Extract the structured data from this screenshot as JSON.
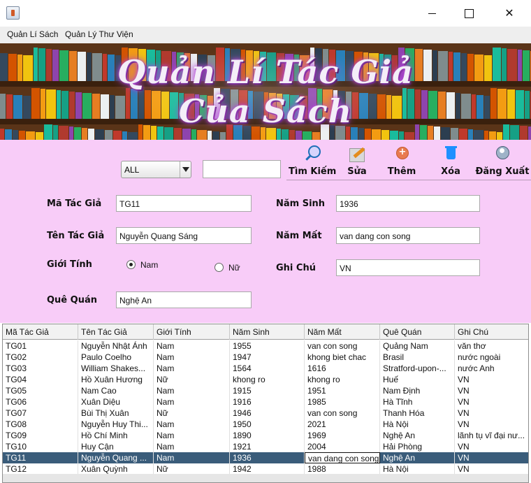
{
  "window": {
    "minimize": "",
    "maximize": "",
    "close": "✕"
  },
  "menu": [
    "Quản Lí Sách",
    "Quản Lý Thư Viện"
  ],
  "banner": {
    "line1": "Quản Lí Tác Giả",
    "line2": "Của Sách"
  },
  "filter": {
    "combo_value": "ALL",
    "search_value": ""
  },
  "toolbar": {
    "search": "Tìm Kiếm",
    "edit": "Sửa",
    "add": "Thêm",
    "delete": "Xóa",
    "logout": "Đăng Xuất"
  },
  "form": {
    "ma_label": "Mã Tác Giả",
    "ma_value": "TG11",
    "ten_label": "Tên Tác Giả",
    "ten_value": "Nguyễn Quang Sáng",
    "gioitinh_label": "Giới Tính",
    "nam_label": "Nam",
    "nu_label": "Nữ",
    "gender_selected": "Nam",
    "que_label": "Quê Quán",
    "que_value": "Nghệ An",
    "namsinh_label": "Năm Sinh",
    "namsinh_value": "1936",
    "nammat_label": "Năm Mất",
    "nammat_value": "van dang con song",
    "ghichu_label": "Ghi Chú",
    "ghichu_value": "VN"
  },
  "table": {
    "columns": [
      "Mã Tác Giả",
      "Tên Tác Giả",
      "Giới Tính",
      "Năm Sinh",
      "Năm Mất",
      "Quê Quán",
      "Ghi Chú"
    ],
    "selected_row": 10,
    "rows": [
      [
        "TG01",
        "Nguyễn Nhật Ánh",
        "Nam",
        "1955",
        "van con song",
        " Quảng Nam",
        "văn thơ"
      ],
      [
        "TG02",
        "Paulo Coelho",
        "Nam",
        "1947",
        "khong biet chac",
        "Brasil",
        "nước ngoài"
      ],
      [
        "TG03",
        "William Shakes...",
        "Nam",
        "1564",
        "1616",
        " Stratford-upon-...",
        "nước Anh"
      ],
      [
        "TG04",
        "Hồ Xuân Hương",
        "Nữ",
        "khong ro",
        "khong ro",
        "Huế",
        "VN"
      ],
      [
        "TG05",
        "Nam Cao",
        "Nam",
        "1915",
        "1951",
        "Nam Định",
        "VN"
      ],
      [
        "TG06",
        "Xuân Diệu",
        "Nam",
        "1916",
        "1985",
        "Hà Tĩnh",
        "VN"
      ],
      [
        "TG07",
        "Bùi Thị Xuân",
        "Nữ",
        "1946",
        "van con song",
        "Thanh Hóa",
        "VN"
      ],
      [
        "TG08",
        "Nguyễn Huy Thi...",
        "Nam",
        "1950",
        "2021",
        "Hà Nội",
        "VN"
      ],
      [
        "TG09",
        "Hồ Chí Minh",
        "Nam",
        "1890",
        "1969",
        "Nghệ An",
        "lãnh tụ vĩ đại nư..."
      ],
      [
        "TG10",
        "Huy Cận",
        "Nam",
        "1921",
        "2004",
        "Hải Phòng",
        "VN"
      ],
      [
        "TG11",
        "Nguyễn Quang ...",
        "Nam",
        "1936",
        "van dang con song",
        "Nghệ An",
        "VN"
      ],
      [
        "TG12",
        "Xuân Quỳnh",
        "Nữ",
        "1942",
        "1988",
        "Hà Nội",
        "VN"
      ]
    ]
  }
}
